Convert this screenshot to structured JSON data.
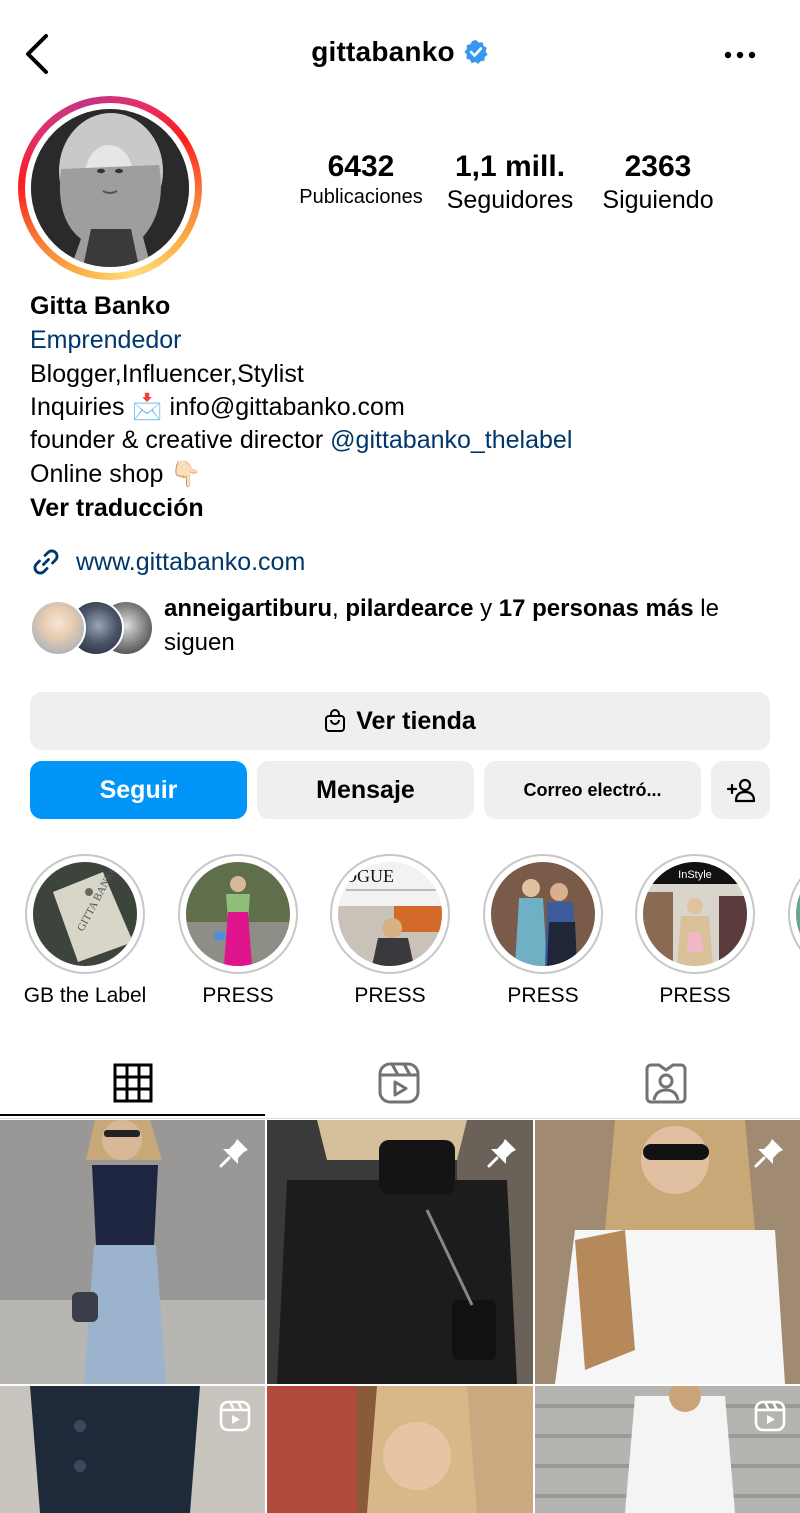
{
  "header": {
    "username": "gittabanko"
  },
  "stats": [
    {
      "value": "6432",
      "label": "Publicaciones"
    },
    {
      "value": "1,1 mill.",
      "label": "Seguidores"
    },
    {
      "value": "2363",
      "label": "Siguiendo"
    }
  ],
  "bio": {
    "name": "Gitta Banko",
    "category": "Emprendedor",
    "line1": "Blogger,Influencer,Stylist",
    "line2_prefix": "Inquiries",
    "line2_emoji": "📩",
    "line2_email": "info@gittabanko.com",
    "line3_prefix": "founder & creative director",
    "line3_mention": "@gittabanko_thelabel",
    "line4_text": "Online shop",
    "line4_emoji": "👇🏻",
    "translate": "Ver traducción",
    "website": "www.gittabanko.com"
  },
  "followed_by": {
    "user1": "anneigartiburu",
    "sep": ",",
    "user2": "pilardearce",
    "conj": "y",
    "others": "17 personas más",
    "suffix": "le siguen"
  },
  "buttons": {
    "shop": "Ver tienda",
    "follow": "Seguir",
    "message": "Mensaje",
    "email": "Correo electró..."
  },
  "highlights": [
    {
      "label": "GB the Label"
    },
    {
      "label": "PRESS"
    },
    {
      "label": "PRESS"
    },
    {
      "label": "PRESS"
    },
    {
      "label": "PRESS"
    }
  ],
  "highlight_badges": {
    "vogue": "OGUE",
    "instyle": "InStyle"
  },
  "colors": {
    "accent_blue": "#0095f6",
    "link": "#00376b",
    "verified": "#3897f0",
    "button_bg": "#efefef"
  },
  "icons": {
    "back": "chevron-left-icon",
    "verified": "verified-badge-icon",
    "more": "more-horizontal-icon",
    "link": "link-icon",
    "shop": "shopping-bag-icon",
    "add_person": "add-person-icon",
    "grid_tab": "grid-icon",
    "reels_tab": "reels-icon",
    "tagged_tab": "tagged-icon",
    "pinned": "pin-icon",
    "reel_post": "reel-icon"
  }
}
